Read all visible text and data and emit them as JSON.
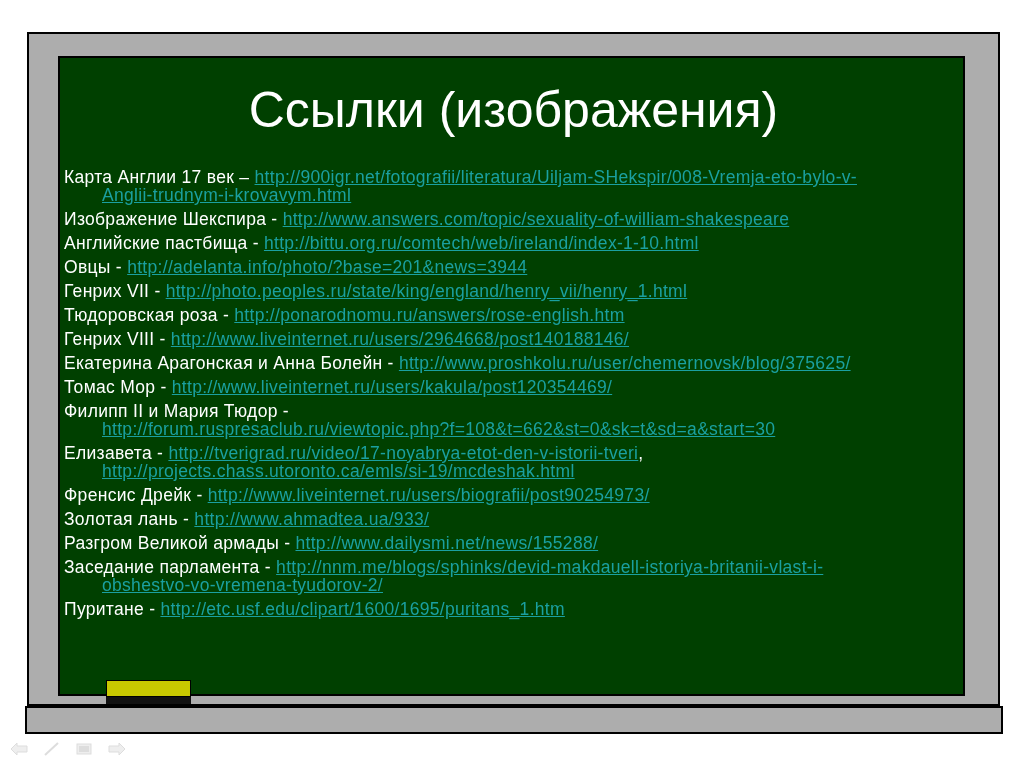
{
  "slide": {
    "title": "Ссылки (изображения)",
    "items": [
      {
        "lines": [
          [
            {
              "kind": "text",
              "text": "Карта Англии 17 век – "
            },
            {
              "kind": "link",
              "text": "http://900igr.net/fotografii/literatura/Uiljam-SHekspir/008-Vremja-eto-bylo-v-"
            }
          ],
          [
            {
              "kind": "link",
              "text": "Anglii-trudnym-i-krovavym.html"
            }
          ]
        ]
      },
      {
        "lines": [
          [
            {
              "kind": "text",
              "text": "Изображение Шекспира - "
            },
            {
              "kind": "link",
              "text": "http://www.answers.com/topic/sexuality-of-william-shakespeare"
            }
          ]
        ]
      },
      {
        "lines": [
          [
            {
              "kind": "text",
              "text": "Английские пастбища - "
            },
            {
              "kind": "link",
              "text": "http://bittu.org.ru/comtech/web/ireland/index-1-10.html"
            }
          ]
        ]
      },
      {
        "lines": [
          [
            {
              "kind": "text",
              "text": "Овцы - "
            },
            {
              "kind": "link",
              "text": "http://adelanta.info/photo/?base=201&news=3944"
            }
          ]
        ]
      },
      {
        "lines": [
          [
            {
              "kind": "text",
              "text": "Генрих VII - "
            },
            {
              "kind": "link",
              "text": "http://photo.peoples.ru/state/king/england/henry_vii/henry_1.html"
            }
          ]
        ]
      },
      {
        "lines": [
          [
            {
              "kind": "text",
              "text": "Тюдоровская роза - "
            },
            {
              "kind": "link",
              "text": "http://ponarodnomu.ru/answers/rose-english.htm"
            }
          ]
        ]
      },
      {
        "lines": [
          [
            {
              "kind": "text",
              "text": "Генрих VIII - "
            },
            {
              "kind": "link",
              "text": "http://www.liveinternet.ru/users/2964668/post140188146/"
            }
          ]
        ]
      },
      {
        "lines": [
          [
            {
              "kind": "text",
              "text": "Екатерина Арагонская и Анна Болейн - "
            },
            {
              "kind": "link",
              "text": "http://www.proshkolu.ru/user/chemernovsk/blog/375625/"
            }
          ]
        ]
      },
      {
        "lines": [
          [
            {
              "kind": "text",
              "text": "Томас Мор - "
            },
            {
              "kind": "link",
              "text": "http://www.liveinternet.ru/users/kakula/post120354469/"
            }
          ]
        ]
      },
      {
        "lines": [
          [
            {
              "kind": "text",
              "text": "Филипп II и Мария Тюдор -"
            }
          ],
          [
            {
              "kind": "link",
              "text": "http://forum.ruspresaclub.ru/viewtopic.php?f=108&t=662&st=0&sk=t&sd=a&start=30"
            }
          ]
        ]
      },
      {
        "lines": [
          [
            {
              "kind": "text",
              "text": "Елизавета - "
            },
            {
              "kind": "link",
              "text": "http://tverigrad.ru/video/17-noyabrya-etot-den-v-istorii-tveri"
            },
            {
              "kind": "text",
              "text": ","
            }
          ],
          [
            {
              "kind": "link",
              "text": "http://projects.chass.utoronto.ca/emls/si-19/mcdeshak.html"
            }
          ]
        ]
      },
      {
        "lines": [
          [
            {
              "kind": "text",
              "text": "Френсис Дрейк - "
            },
            {
              "kind": "link",
              "text": "http://www.liveinternet.ru/users/biografii/post90254973/"
            }
          ]
        ]
      },
      {
        "lines": [
          [
            {
              "kind": "text",
              "text": "Золотая лань - "
            },
            {
              "kind": "link",
              "text": "http://www.ahmadtea.ua/933/"
            }
          ]
        ]
      },
      {
        "lines": [
          [
            {
              "kind": "text",
              "text": "Разгром Великой армады - "
            },
            {
              "kind": "link",
              "text": "http://www.dailysmi.net/news/155288/"
            }
          ]
        ]
      },
      {
        "lines": [
          [
            {
              "kind": "text",
              "text": "Заседание парламента - "
            },
            {
              "kind": "link",
              "text": "http://nnm.me/blogs/sphinks/devid-makdauell-istoriya-britanii-vlast-i-"
            }
          ],
          [
            {
              "kind": "link",
              "text": "obshestvo-vo-vremena-tyudorov-2/"
            }
          ]
        ]
      },
      {
        "lines": [
          [
            {
              "kind": "text",
              "text": "Пуритане - "
            },
            {
              "kind": "link",
              "text": "http://etc.usf.edu/clipart/1600/1695/puritans_1.htm"
            }
          ]
        ]
      }
    ]
  }
}
